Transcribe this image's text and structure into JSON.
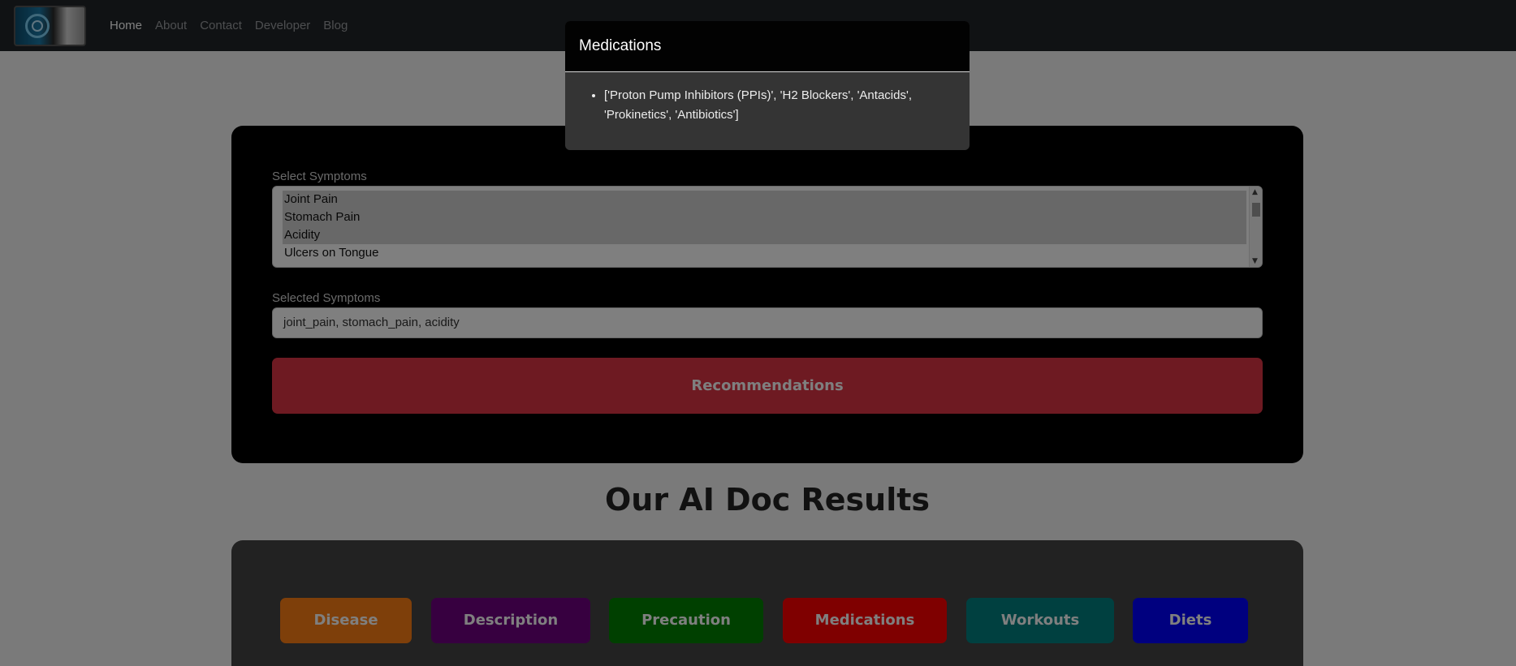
{
  "navbar": {
    "logo_icon": "medical-logo-icon",
    "links": [
      {
        "label": "Home",
        "active": true
      },
      {
        "label": "About",
        "active": false
      },
      {
        "label": "Contact",
        "active": false
      },
      {
        "label": "Developer",
        "active": false
      },
      {
        "label": "Blog",
        "active": false
      }
    ]
  },
  "form": {
    "select_label": "Select Symptoms",
    "options": [
      {
        "label": "Joint Pain",
        "selected": true
      },
      {
        "label": "Stomach Pain",
        "selected": true
      },
      {
        "label": "Acidity",
        "selected": true
      },
      {
        "label": "Ulcers on Tongue",
        "selected": false
      }
    ],
    "selected_label": "Selected Symptoms",
    "selected_value": "joint_pain, stomach_pain, acidity",
    "button_label": "Recommendations",
    "button_color": "#dc3545"
  },
  "results": {
    "title": "Our AI Doc Results",
    "buttons": [
      {
        "label": "Disease",
        "color": "#fd7e14"
      },
      {
        "label": "Description",
        "color": "#6f0080"
      },
      {
        "label": "Precaution",
        "color": "#008000"
      },
      {
        "label": "Medications",
        "color": "#ff0000"
      },
      {
        "label": "Workouts",
        "color": "#008080"
      },
      {
        "label": "Diets",
        "color": "#0000ff"
      }
    ]
  },
  "modal": {
    "title": "Medications",
    "items": [
      "['Proton Pump Inhibitors (PPIs)', 'H2 Blockers', 'Antacids', 'Prokinetics', 'Antibiotics']"
    ]
  }
}
